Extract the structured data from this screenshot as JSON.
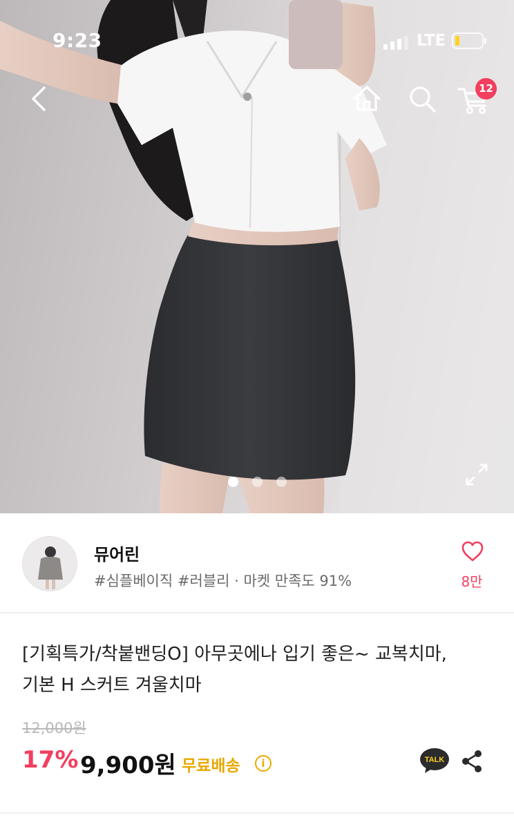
{
  "status_bar": {
    "time": "9:23",
    "network": "LTE",
    "signal_bars": 4,
    "signal_active_bars": 3,
    "battery_level": 0.15,
    "battery_color": "#ffd21f"
  },
  "header": {
    "icons": [
      "chevron-left-icon",
      "home-icon",
      "search-icon",
      "cart-icon"
    ],
    "cart_count": "12"
  },
  "gallery": {
    "image_count": 3,
    "active_index": 0,
    "expand_icon": "expand-icon"
  },
  "shop": {
    "name": "뮤어린",
    "tags": "#심플베이직 #러블리 · 마켓 만족도 91%",
    "like_count": "8만",
    "like_icon": "heart-outline-icon"
  },
  "product": {
    "title_line1": "[기획특가/착붙밴딩O] 아무곳에나 입기 좋은~ 교복치마,",
    "title_line2": "기본 H 스커트 겨울치마",
    "original_price": "12,000원",
    "discount_rate": "17%",
    "sale_price": "9,900원",
    "shipping": "무료배송",
    "info_icon_glyph": "i",
    "talk_label": "TALK",
    "share_icon": "share-icon"
  },
  "colors": {
    "accent_pink": "#f23f5f",
    "shipping_yellow": "#e9a800",
    "talk_bubble": "#2b2b2b"
  }
}
